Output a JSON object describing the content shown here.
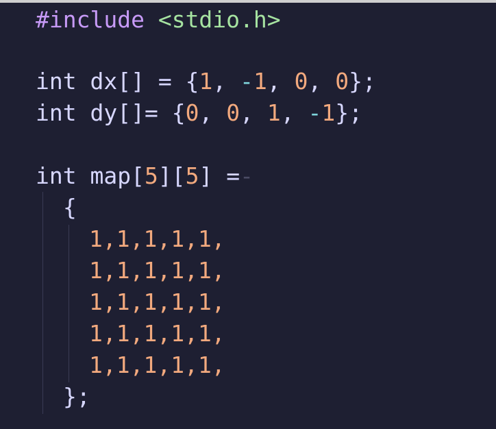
{
  "code": {
    "line1": {
      "directive": "#include",
      "header": "<stdio.h>"
    },
    "line2": {
      "type": "int",
      "name": "dx[]",
      "eq": " = ",
      "open": "{",
      "v1": "1",
      "c1": ", ",
      "v2": "-1",
      "c2": ", ",
      "v3": "0",
      "c3": ", ",
      "v4": "0",
      "close": "};"
    },
    "line3": {
      "type": "int",
      "name": "dy[]",
      "eq": "= ",
      "open": "{",
      "v1": "0",
      "c1": ", ",
      "v2": "0",
      "c2": ", ",
      "v3": "1",
      "c3": ", ",
      "v4": "-1",
      "close": "};"
    },
    "line4": {
      "type": "int",
      "name": "map",
      "b1": "[",
      "n1": "5",
      "b2": "][",
      "n2": "5",
      "b3": "]",
      "eq": " =",
      "trail": "-"
    },
    "line5": {
      "brace": "{"
    },
    "rows": [
      "1,1,1,1,1,",
      "1,1,1,1,1,",
      "1,1,1,1,1,",
      "1,1,1,1,1,",
      "1,1,1,1,1,"
    ],
    "line_end": "};"
  },
  "colors": {
    "background": "#1e1f32",
    "directive": "#c79af7",
    "include_header": "#a6e3a1",
    "number": "#f2a97e",
    "operator": "#7fd5dc",
    "text": "#d7d7ff"
  }
}
